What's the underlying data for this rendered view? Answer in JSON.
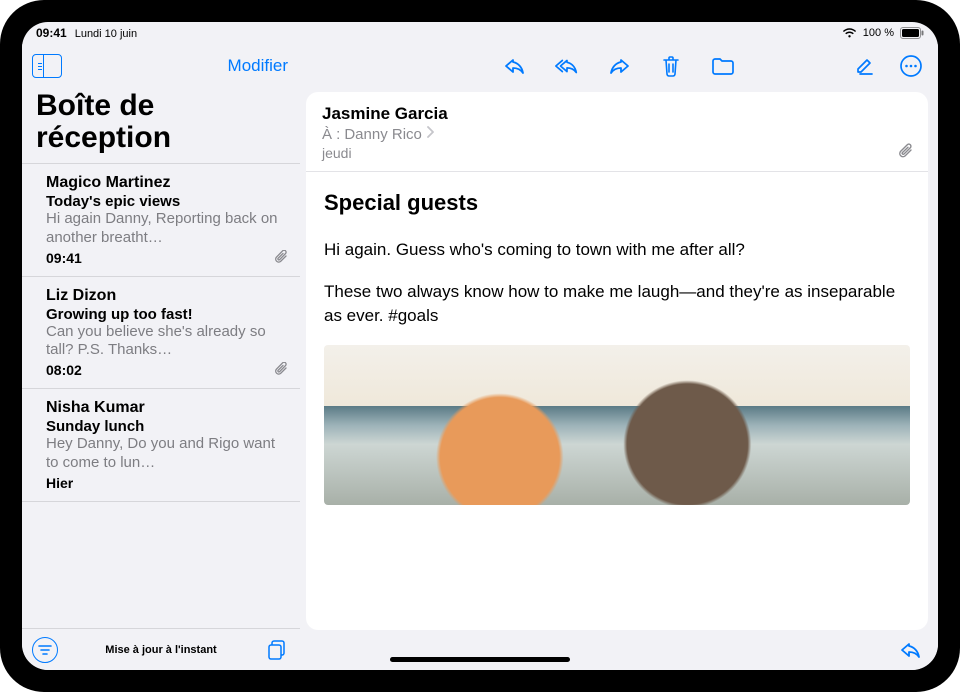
{
  "status": {
    "time": "09:41",
    "date": "Lundi 10 juin",
    "battery_text": "100 %"
  },
  "sidebar": {
    "edit_label": "Modifier",
    "title": "Boîte de réception",
    "footer_status": "Mise à jour à l'instant",
    "messages": [
      {
        "sender": "Magico Martinez",
        "subject": "Today's epic views",
        "preview": "Hi again Danny, Reporting back on another breatht…",
        "time": "09:41",
        "has_attachment": true
      },
      {
        "sender": "Liz Dizon",
        "subject": "Growing up too fast!",
        "preview": "Can you believe she's already so tall? P.S. Thanks…",
        "time": "08:02",
        "has_attachment": true
      },
      {
        "sender": "Nisha Kumar",
        "subject": "Sunday lunch",
        "preview": "Hey Danny, Do you and Rigo want to come to lun…",
        "time": "Hier",
        "has_attachment": false
      }
    ]
  },
  "message": {
    "from": "Jasmine Garcia",
    "to_label": "À :",
    "to_name": "Danny Rico",
    "date": "jeudi",
    "subject": "Special guests",
    "paragraphs": [
      "Hi again. Guess who's coming to town with me after all?",
      "These two always know how to make me laugh—and they're as inseparable as ever. #goals"
    ]
  },
  "icons": {
    "sidebar_toggle": "sidebar-toggle-icon",
    "reply": "reply-icon",
    "reply_all": "reply-all-icon",
    "forward": "forward-icon",
    "trash": "trash-icon",
    "move": "folder-icon",
    "compose": "compose-icon",
    "more": "more-icon",
    "filter": "filter-icon",
    "copy": "copy-icon",
    "attachment": "paperclip-icon",
    "wifi": "wifi-icon",
    "battery": "battery-icon"
  },
  "colors": {
    "accent": "#007aff"
  }
}
